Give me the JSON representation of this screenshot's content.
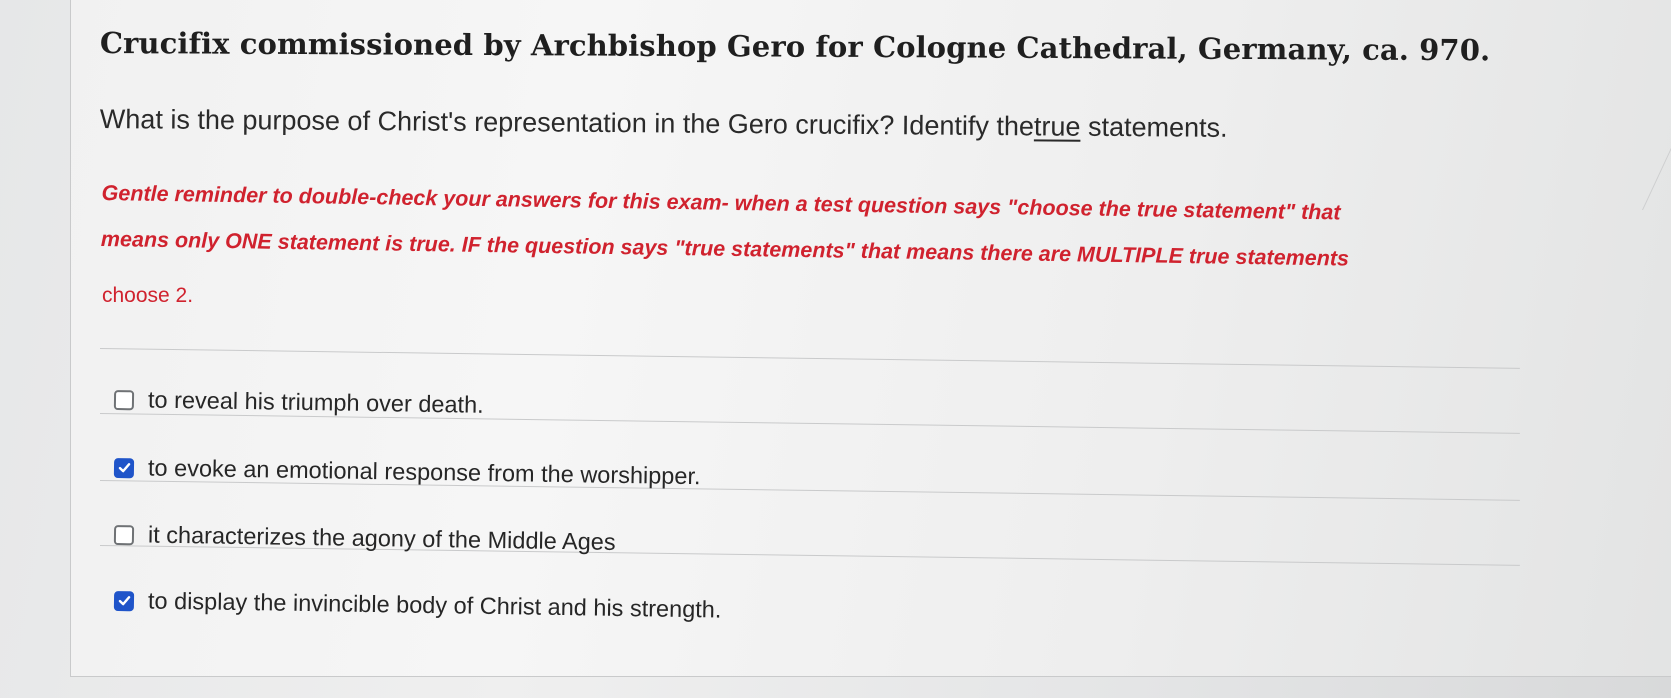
{
  "question": {
    "title": "Crucifix commissioned by Archbishop Gero for Cologne Cathedral, Germany, ca. 970.",
    "prompt_before": "What is the purpose of Christ's representation in the Gero crucifix? Identify the",
    "prompt_underlined": "true",
    "prompt_after": " statements.",
    "reminder_line1": "Gentle reminder to double-check your answers for this exam- when a test question says \"choose the true statement\" that",
    "reminder_line2": "means only ONE statement is true. IF the question says \"true statements\" that means there are MULTIPLE true statements",
    "choose_text": "choose 2."
  },
  "answers": [
    {
      "label": "to reveal his triumph over death.",
      "checked": false
    },
    {
      "label": "to evoke an emotional response from the worshipper.",
      "checked": true
    },
    {
      "label": "it characterizes the agony of the Middle Ages",
      "checked": false
    },
    {
      "label": "to display the invincible body of Christ and his strength.",
      "checked": true
    }
  ],
  "colors": {
    "reminder_red": "#d0222e",
    "checkbox_blue": "#1f54c9"
  },
  "icons": {
    "checked": "checkmark-icon",
    "unchecked": "empty-checkbox-icon"
  }
}
